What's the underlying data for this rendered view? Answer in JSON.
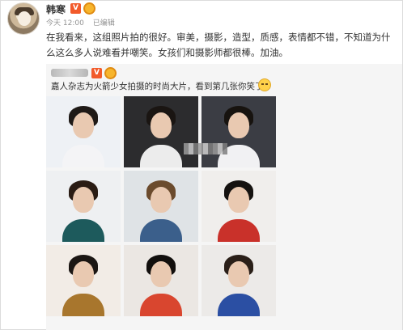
{
  "post": {
    "username": "韩寒",
    "verified_badge": "V",
    "meta": {
      "time": "今天 12:00",
      "edited": "已编辑"
    },
    "text": "在我看来，这组照片拍的很好。审美，摄影，造型，质感，表情都不错，不知道为什么这么多人说难看并嘲笑。女孩们和摄影师都很棒。加油。"
  },
  "repost": {
    "verified_badge": "V",
    "text": "嘉人杂志为火箭少女拍摄的时尚大片，看到第几张你笑了?",
    "emoji_icon": "smirk-emoji",
    "photos": [
      {
        "bg": "#eef1f5",
        "hair": "#1f1a17",
        "top": "#f4f4f6"
      },
      {
        "bg": "#2c2c2e",
        "hair": "#1a1512",
        "top": "#ececec"
      },
      {
        "bg": "#3b3d44",
        "hair": "#17130f",
        "top": "#f1f1f3"
      },
      {
        "bg": "#eef0f2",
        "hair": "#2a1c14",
        "top": "#1d5a5c"
      },
      {
        "bg": "#dfe3e6",
        "hair": "#6b4b2d",
        "top": "#3b5f8b"
      },
      {
        "bg": "#f0eeec",
        "hair": "#151210",
        "top": "#c9312a"
      },
      {
        "bg": "#f2ece6",
        "hair": "#1b1613",
        "top": "#a8762d"
      },
      {
        "bg": "#ebe7e3",
        "hair": "#120f0d",
        "top": "#d9462f"
      },
      {
        "bg": "#eceae8",
        "hair": "#2a1f18",
        "top": "#2b4fa3"
      }
    ]
  },
  "colors": {
    "accent_orange": "#f25a2a",
    "muted": "#939393",
    "repost_bg": "#f5f5f5"
  }
}
